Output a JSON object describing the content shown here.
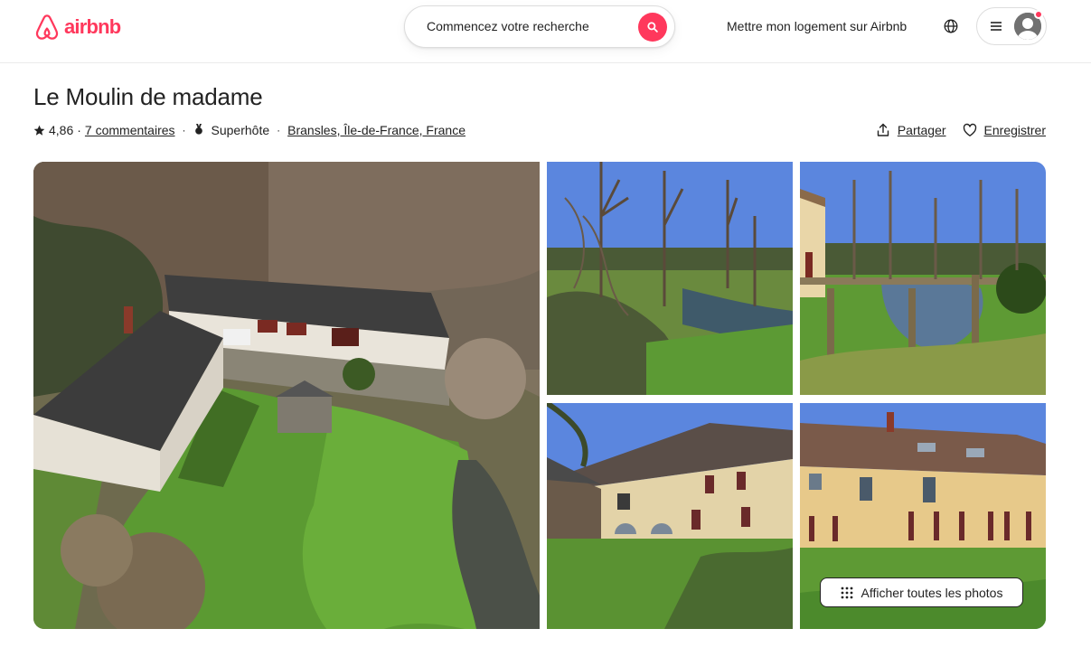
{
  "header": {
    "logo_text": "airbnb",
    "search_placeholder": "Commencez votre recherche",
    "host_link": "Mettre mon logement sur Airbnb",
    "icons": [
      "airbnb-logo-icon",
      "search-icon",
      "globe-icon",
      "menu-icon",
      "user-avatar-icon"
    ],
    "brand_color": "#FF385C"
  },
  "listing": {
    "title": "Le Moulin de madame",
    "rating": "4,86",
    "reviews_link": "7 commentaires",
    "superhost_label": "Superhôte",
    "location": "Bransles, Île-de-France, France",
    "share_label": "Partager",
    "save_label": "Enregistrer"
  },
  "gallery": {
    "show_all_label": "Afficher toutes les photos",
    "photos": [
      "aerial view of mill buildings and garden",
      "river with bare trees",
      "pond with wooden railing",
      "house facade with arched windows",
      "yellow house with red shutters"
    ]
  }
}
